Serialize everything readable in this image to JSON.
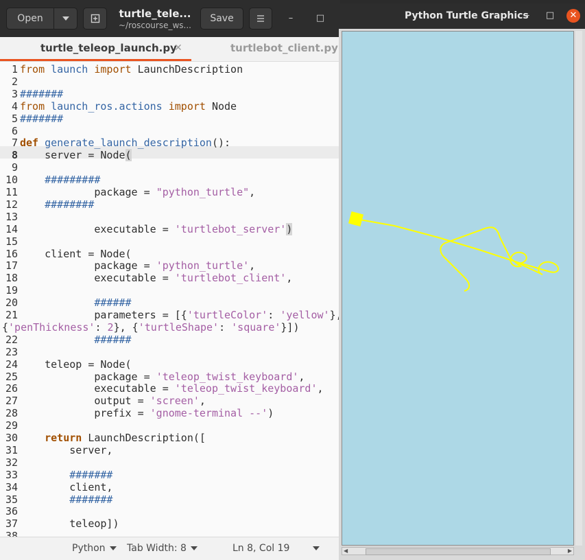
{
  "gedit": {
    "open_label": "Open",
    "save_label": "Save",
    "title": "turtle_tele...",
    "subtitle": "~/roscourse_ws...",
    "tabs": [
      {
        "label": "turtle_teleop_launch.py",
        "active": true
      },
      {
        "label": "turtlebot_client.py",
        "active": false
      }
    ],
    "cursor_line": 8,
    "code_lines": [
      {
        "n": "1",
        "text": "from launch import LaunchDescription"
      },
      {
        "n": "2",
        "text": ""
      },
      {
        "n": "3",
        "text": "#######"
      },
      {
        "n": "4",
        "text": "from launch_ros.actions import Node"
      },
      {
        "n": "5",
        "text": "#######"
      },
      {
        "n": "6",
        "text": ""
      },
      {
        "n": "7",
        "text": "def generate_launch_description():"
      },
      {
        "n": "8",
        "text": "    server = Node("
      },
      {
        "n": "9",
        "text": ""
      },
      {
        "n": "10",
        "text": "    #########"
      },
      {
        "n": "11",
        "text": "            package = \"python_turtle\","
      },
      {
        "n": "12",
        "text": "    ########"
      },
      {
        "n": "13",
        "text": ""
      },
      {
        "n": "14",
        "text": "            executable = 'turtlebot_server')"
      },
      {
        "n": "15",
        "text": ""
      },
      {
        "n": "16",
        "text": "    client = Node("
      },
      {
        "n": "17",
        "text": "            package = 'python_turtle',"
      },
      {
        "n": "18",
        "text": "            executable = 'turtlebot_client',"
      },
      {
        "n": "19",
        "text": ""
      },
      {
        "n": "20",
        "text": "            ######"
      },
      {
        "n": "21",
        "text": "            parameters = [{'turtleColor': 'yellow'},"
      },
      {
        "n": "",
        "text": "{'penThickness': 2}, {'turtleShape': 'square'}])"
      },
      {
        "n": "22",
        "text": "            ######"
      },
      {
        "n": "23",
        "text": ""
      },
      {
        "n": "24",
        "text": "    teleop = Node("
      },
      {
        "n": "25",
        "text": "            package = 'teleop_twist_keyboard',"
      },
      {
        "n": "26",
        "text": "            executable = 'teleop_twist_keyboard',"
      },
      {
        "n": "27",
        "text": "            output = 'screen',"
      },
      {
        "n": "28",
        "text": "            prefix = 'gnome-terminal --')"
      },
      {
        "n": "29",
        "text": ""
      },
      {
        "n": "30",
        "text": "    return LaunchDescription(["
      },
      {
        "n": "31",
        "text": "        server,"
      },
      {
        "n": "32",
        "text": ""
      },
      {
        "n": "33",
        "text": "        #######"
      },
      {
        "n": "34",
        "text": "        client,"
      },
      {
        "n": "35",
        "text": "        #######"
      },
      {
        "n": "36",
        "text": ""
      },
      {
        "n": "37",
        "text": "        teleop])"
      },
      {
        "n": "38",
        "text": ""
      }
    ],
    "status": {
      "language": "Python",
      "tab_width": "Tab Width: 8",
      "position": "Ln 8, Col 19"
    },
    "colors": {
      "keyword": "#a14f00",
      "function": "#3465a4",
      "string": "#a45ea4",
      "comment": "#3465a4",
      "number": "#a45ea4",
      "accent": "#e95420"
    }
  },
  "turtle_window": {
    "title": "Python Turtle Graphics",
    "canvas_bg": "#add8e6",
    "pen_color": "#ffff00",
    "turtle_shape": "square"
  }
}
